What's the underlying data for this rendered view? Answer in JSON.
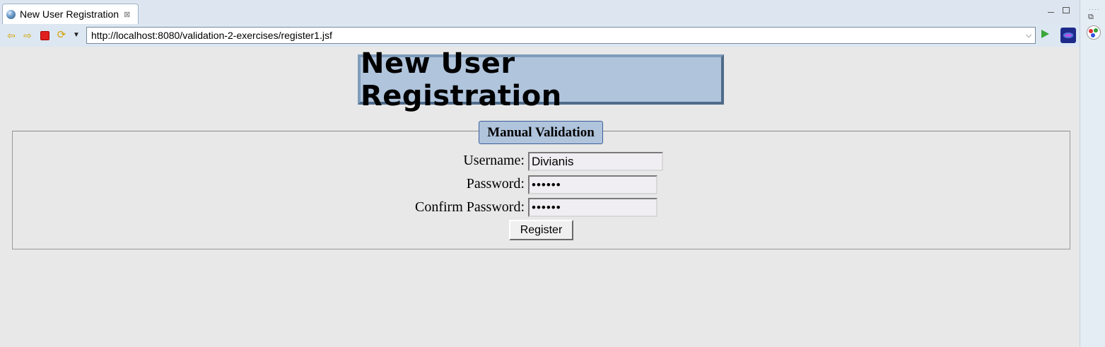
{
  "tab": {
    "title": "New User Registration",
    "close_glyph": "⊠"
  },
  "toolbar": {
    "url": "http://localhost:8080/validation-2-exercises/register1.jsf"
  },
  "page": {
    "heading": "New User Registration",
    "legend": "Manual Validation",
    "fields": {
      "username_label": "Username:",
      "username_value": "Divianis",
      "password_label": "Password:",
      "password_value": "••••••",
      "confirm_label": "Confirm Password:",
      "confirm_value": "••••••"
    },
    "register_label": "Register"
  },
  "icons": {
    "back": "back-arrow-icon",
    "forward": "forward-arrow-icon",
    "stop": "stop-icon",
    "refresh": "refresh-icon",
    "go": "go-icon"
  },
  "colors": {
    "header_bg": "#b0c4dc",
    "header_border": "#4f6b8a",
    "page_bg": "#e8e8e8"
  }
}
